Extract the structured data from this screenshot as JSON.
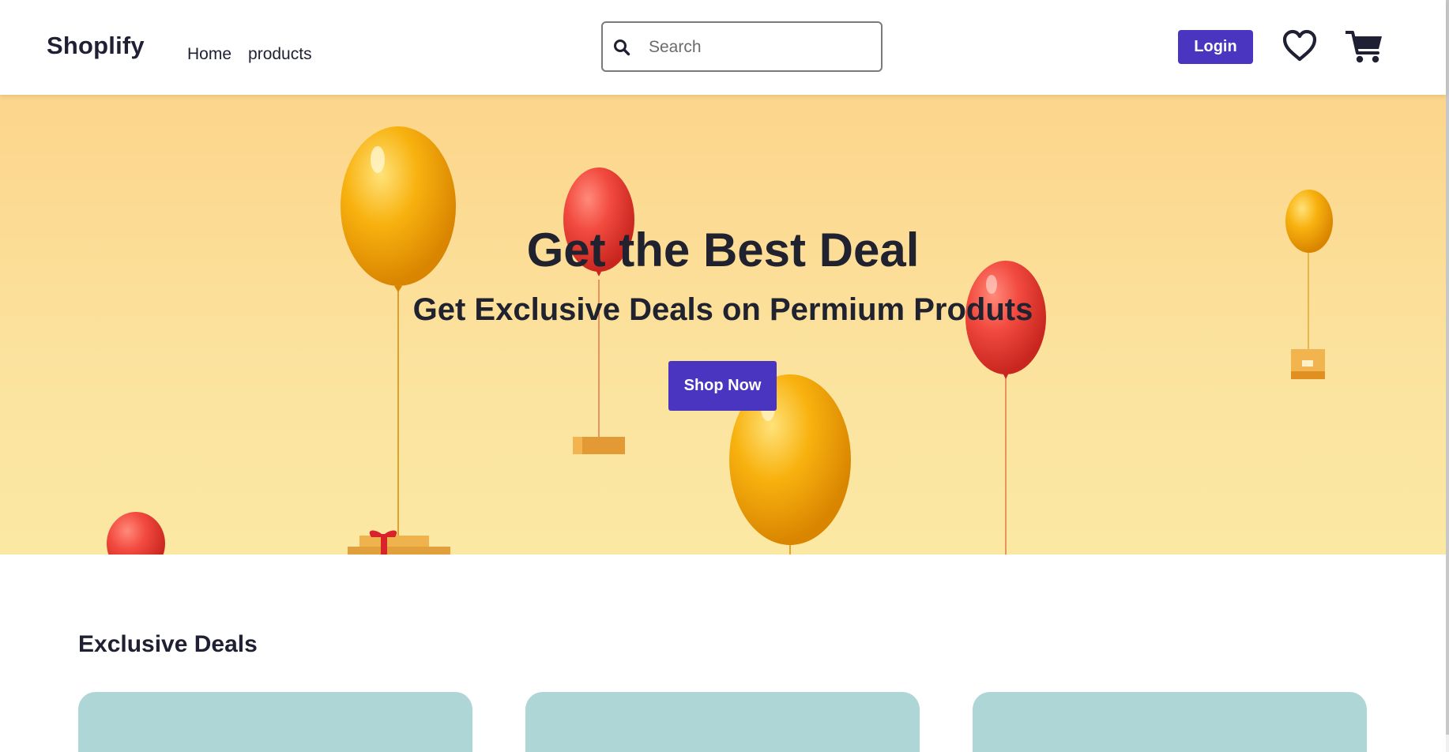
{
  "header": {
    "brand": "Shoplify",
    "nav": [
      {
        "label": "Home"
      },
      {
        "label": "products"
      }
    ],
    "search": {
      "placeholder": "Search",
      "value": "",
      "icon": "search-icon"
    },
    "login_label": "Login",
    "icons": [
      "heart-icon",
      "cart-icon"
    ]
  },
  "hero": {
    "title": "Get the Best Deal",
    "subtitle": "Get Exclusive Deals on Permium Produts",
    "cta_label": "Shop Now"
  },
  "deals": {
    "title": "Exclusive Deals",
    "cards": 3
  },
  "colors": {
    "accent": "#4a35c0",
    "text": "#1f2033",
    "hero_bg": "#fcdc95",
    "card_bg": "#aed6d6"
  }
}
